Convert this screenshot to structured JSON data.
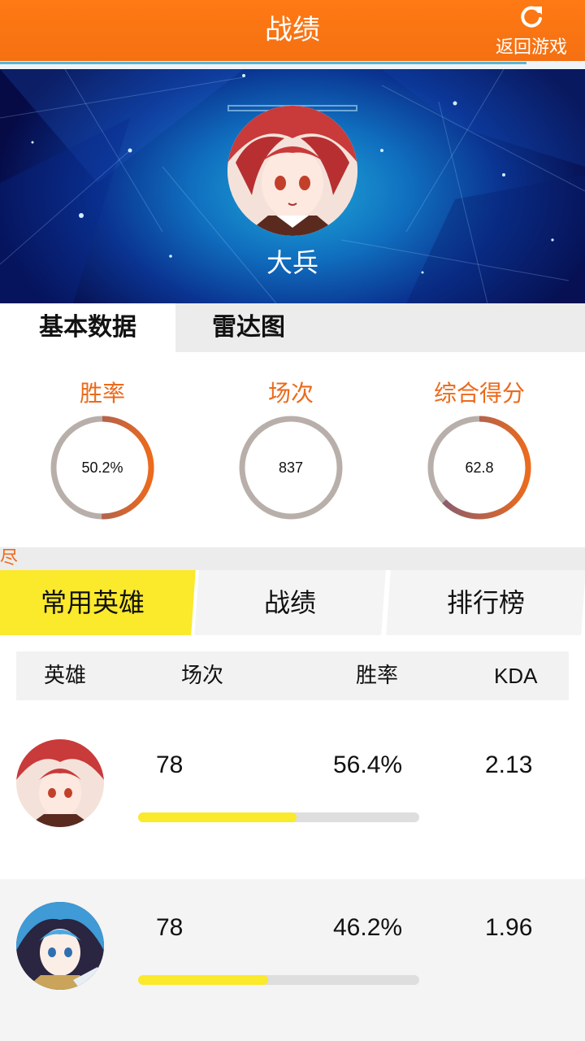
{
  "header": {
    "title": "战绩",
    "back_label": "返回游戏",
    "back_icon": "refresh-icon",
    "color": "#f97316"
  },
  "profile": {
    "name": "大兵",
    "avatar": "avatar-red-hair-girl"
  },
  "top_tabs": [
    {
      "label": "基本数据",
      "active": true
    },
    {
      "label": "雷达图",
      "active": false
    }
  ],
  "stats": [
    {
      "label": "胜率",
      "value": "50.2%",
      "ring_fraction": 0.502
    },
    {
      "label": "场次",
      "value": "837",
      "ring_fraction": 0
    },
    {
      "label": "综合得分",
      "value": "62.8",
      "ring_fraction": 0.628
    }
  ],
  "strip_text": "尽",
  "lower_tabs": [
    {
      "label": "常用英雄",
      "active": true
    },
    {
      "label": "战绩",
      "active": false
    },
    {
      "label": "排行榜",
      "active": false
    }
  ],
  "table": {
    "columns": [
      "英雄",
      "场次",
      "胜率",
      "KDA"
    ],
    "rows": [
      {
        "hero_icon": "hero-red-hair-avatar",
        "games": "78",
        "win_rate": "56.4%",
        "win_fraction": 0.564,
        "kda": "2.13"
      },
      {
        "hero_icon": "hero-blue-hair-avatar",
        "games": "78",
        "win_rate": "46.2%",
        "win_fraction": 0.462,
        "kda": "1.96"
      }
    ]
  },
  "colors": {
    "accent_orange": "#ec6a1c",
    "tab_yellow": "#fbe92c",
    "ring_gray": "#b8afaa"
  }
}
